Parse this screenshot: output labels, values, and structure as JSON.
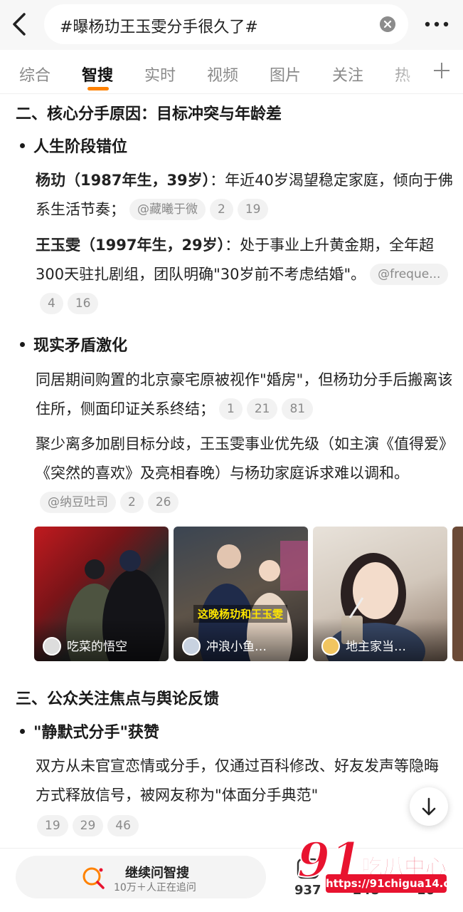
{
  "header": {
    "search_query": "#曝杨玏王玉雯分手很久了#"
  },
  "tabs": [
    {
      "label": "综合"
    },
    {
      "label": "智搜"
    },
    {
      "label": "实时"
    },
    {
      "label": "视频"
    },
    {
      "label": "图片"
    },
    {
      "label": "关注"
    },
    {
      "label": "热"
    }
  ],
  "content": {
    "section2_title": "二、核心分手原因：目标冲突与年龄差",
    "bullet1": "人生阶段错位",
    "p1_bold": "杨玏（1987年生，39岁）",
    "p1_text": "：年近40岁渴望稳定家庭，倾向于佛系生活节奏；",
    "p1_chips": [
      "@藏曦于微",
      "2",
      "19"
    ],
    "p2_bold": "王玉雯（1997年生，29岁）",
    "p2_text": "：处于事业上升黄金期，全年超300天驻扎剧组，团队明确\"30岁前不考虑结婚\"。",
    "p2_chips": [
      "@freque...",
      "4",
      "16"
    ],
    "bullet2": "现实矛盾激化",
    "p3_text": "同居期间购置的北京豪宅原被视作\"婚房\"，但杨玏分手后搬离该住所，侧面印证关系终结；",
    "p3_chips": [
      "1",
      "21",
      "81"
    ],
    "p4_text": "聚少离多加剧目标分歧，王玉雯事业优先级（如主演《值得爱》《突然的喜欢》及亮相春晚）与杨玏家庭诉求难以调和。",
    "p4_chips": [
      "@纳豆吐司",
      "2",
      "26"
    ],
    "images": [
      {
        "author": "吃菜的悟空",
        "caption": ""
      },
      {
        "author": "冲浪小鱼…",
        "caption": "这晚杨玏和王玉雯"
      },
      {
        "author": "地主家当…",
        "caption": ""
      }
    ],
    "section3_title": "三、公众关注焦点与舆论反馈",
    "bullet3": "\"静默式分手\"获赞",
    "p5_text": "双方从未官宣恋情或分手，仅通过百科修改、好友发声等隐晦方式释放信号，被网友称为\"体面分手典范\"",
    "p5_chips": [
      "19",
      "29",
      "46"
    ]
  },
  "bottom": {
    "ask_title": "继续问智搜",
    "ask_sub": "10万＋人正在追问",
    "stats": [
      "937",
      "248",
      "16"
    ]
  },
  "watermark": {
    "logo": "91",
    "text": "吃瓜中心",
    "url": "https://91chigua14.com"
  },
  "colors": {
    "accent": "#ff8200",
    "watermark": "#e8132f"
  }
}
